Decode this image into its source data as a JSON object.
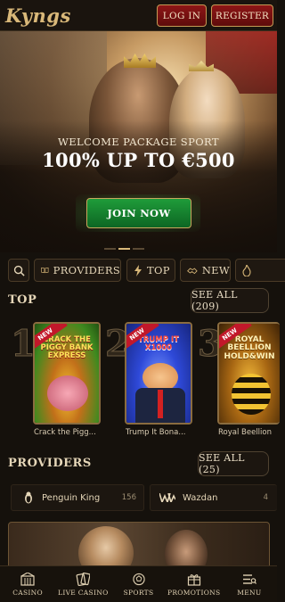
{
  "header": {
    "logo": "Kyngs",
    "login_label": "LOG IN",
    "register_label": "REGISTER"
  },
  "hero": {
    "welcome": "WELCOME PACKAGE SPORT",
    "offer": "100% UP TO €500",
    "join_label": "JOIN NOW",
    "slides": 3,
    "active_slide": 1
  },
  "filters": [
    {
      "label": "PROVIDERS",
      "icon": "book-icon"
    },
    {
      "label": "TOP",
      "icon": "lightning-icon"
    },
    {
      "label": "NEW",
      "icon": "handshake-icon"
    }
  ],
  "top": {
    "title": "TOP",
    "see_all": "SEE ALL (209)",
    "games": [
      {
        "rank": "1",
        "name": "Crack the Pigg...",
        "art": "CRACK THE PIGGY BANK EXPRESS",
        "badge": "NEW",
        "bg": "#3f8a1f"
      },
      {
        "rank": "2",
        "name": "Trump It Bona...",
        "art": "TRUMP IT X1000",
        "badge": "NEW",
        "bg": "#2238c8"
      },
      {
        "rank": "3",
        "name": "Royal Beellion",
        "art": "ROYAL BEELLION HOLD&WIN",
        "badge": "NEW",
        "bg": "#7a4a0a"
      }
    ]
  },
  "providers": {
    "title": "PROVIDERS",
    "see_all": "SEE ALL (25)",
    "items": [
      {
        "name": "Penguin King",
        "count": "156"
      },
      {
        "name": "Wazdan",
        "count": "4"
      }
    ]
  },
  "nav": [
    {
      "label": "CASINO",
      "icon": "casino-icon"
    },
    {
      "label": "LIVE CASINO",
      "icon": "cards-icon"
    },
    {
      "label": "SPORTS",
      "icon": "ball-icon"
    },
    {
      "label": "PROMOTIONS",
      "icon": "gift-icon"
    },
    {
      "label": "MENU",
      "icon": "menu-icon"
    }
  ],
  "colors": {
    "accent": "#d9b879",
    "register_red": "#8e1616",
    "join_green": "#1f9c3a"
  }
}
